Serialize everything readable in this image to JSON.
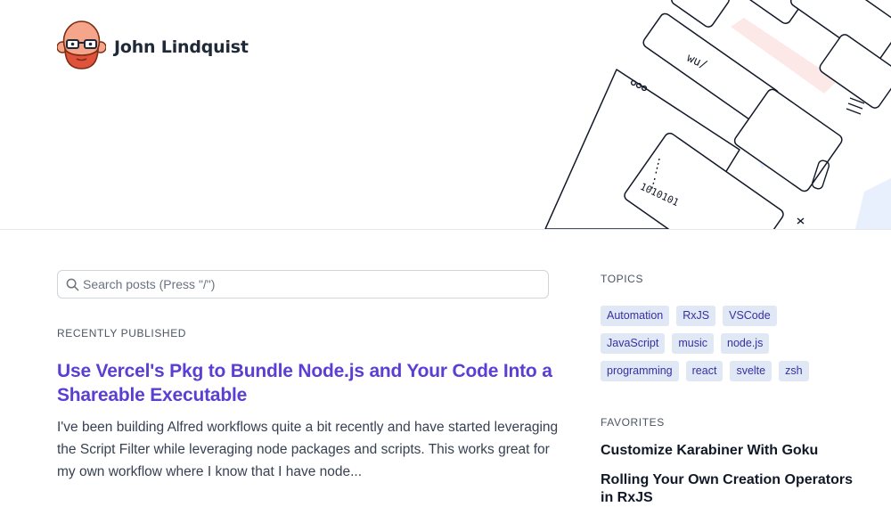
{
  "site": {
    "name": "John Lindquist"
  },
  "hero_art": {
    "glyph_labels": [
      "wu/",
      "1010101"
    ]
  },
  "search": {
    "placeholder": "Search posts (Press \"/\")"
  },
  "recent": {
    "heading": "RECENTLY PUBLISHED",
    "post_title": "Use Vercel's Pkg to Bundle Node.js and Your Code Into a Shareable Executable",
    "post_excerpt": "I've been building Alfred workflows quite a bit recently and have started leveraging the Script Filter while leveraging node packages and scripts. This works great for my own workflow where I know that I have node..."
  },
  "topics": {
    "heading": "TOPICS",
    "items": [
      "Automation",
      "RxJS",
      "VSCode",
      "JavaScript",
      "music",
      "node.js",
      "programming",
      "react",
      "svelte",
      "zsh"
    ]
  },
  "favorites": {
    "heading": "FAVORITES",
    "items": [
      "Customize Karabiner With Goku",
      "Rolling Your Own Creation Operators in RxJS"
    ]
  },
  "colors": {
    "accent": "#5b3fd3",
    "tag_bg": "#e0e7f5",
    "tag_text": "#3730a3"
  }
}
